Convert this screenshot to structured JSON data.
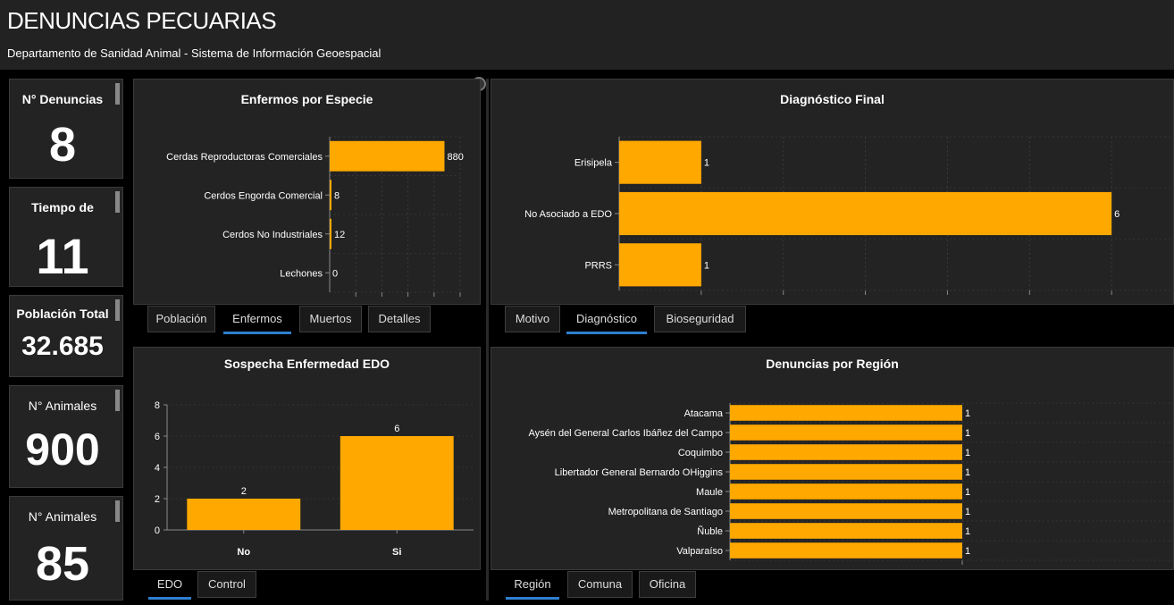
{
  "header": {
    "title": "DENUNCIAS PECUARIAS",
    "subtitle": "Departamento de Sanidad Animal - Sistema de Información Geoespacial"
  },
  "kpis": [
    {
      "label": "N° Denuncias",
      "value": "8"
    },
    {
      "label": "Tiempo de",
      "value": "11"
    },
    {
      "label": "Población Total",
      "value": "32.685"
    },
    {
      "label": "N° Animales",
      "value": "900"
    },
    {
      "label": "N° Animales",
      "value": "85"
    }
  ],
  "panels": {
    "especie": {
      "title": "Enfermos por Especie",
      "tabs": [
        "Población",
        "Enfermos",
        "Muertos",
        "Detalles"
      ],
      "active_tab": 1
    },
    "diagnostico": {
      "title": "Diagnóstico Final",
      "tabs": [
        "Motivo",
        "Diagnóstico",
        "Bioseguridad"
      ],
      "active_tab": 1
    },
    "sospecha": {
      "title": "Sospecha Enfermedad EDO",
      "tabs": [
        "EDO",
        "Control"
      ],
      "active_tab": 0
    },
    "region": {
      "title": "Denuncias por Región",
      "tabs": [
        "Región",
        "Comuna",
        "Oficina"
      ],
      "active_tab": 0
    }
  },
  "chart_data": [
    {
      "type": "bar",
      "orientation": "horizontal",
      "title": "Enfermos por Especie",
      "categories": [
        "Cerdas Reproductoras Comerciales",
        "Cerdos Engorda Comercial",
        "Cerdos No Industriales",
        "Lechones"
      ],
      "values": [
        880,
        8,
        12,
        0
      ],
      "xlim": [
        0,
        1000
      ],
      "grid": true,
      "color": "#FFA800"
    },
    {
      "type": "bar",
      "orientation": "horizontal",
      "title": "Diagnóstico Final",
      "categories": [
        "Erisipela",
        "No Asociado a EDO",
        "PRRS"
      ],
      "values": [
        1,
        6,
        1
      ],
      "xlim": [
        0,
        7
      ],
      "grid": true,
      "color": "#FFA800"
    },
    {
      "type": "bar",
      "orientation": "vertical",
      "title": "Sospecha Enfermedad EDO",
      "categories": [
        "No",
        "Si"
      ],
      "values": [
        2,
        6
      ],
      "ylim": [
        0,
        8
      ],
      "yticks": [
        0,
        2,
        4,
        6,
        8
      ],
      "grid": true,
      "color": "#FFA800"
    },
    {
      "type": "bar",
      "orientation": "horizontal",
      "title": "Denuncias por Región",
      "categories": [
        "Atacama",
        "Aysén del General Carlos Ibáñez del Campo",
        "Coquimbo",
        "Libertador General Bernardo OHiggins",
        "Maule",
        "Metropolitana de Santiago",
        "Ñuble",
        "Valparaíso"
      ],
      "values": [
        1,
        1,
        1,
        1,
        1,
        1,
        1,
        1
      ],
      "xlim": [
        0,
        2
      ],
      "grid": true,
      "color": "#FFA800"
    }
  ]
}
